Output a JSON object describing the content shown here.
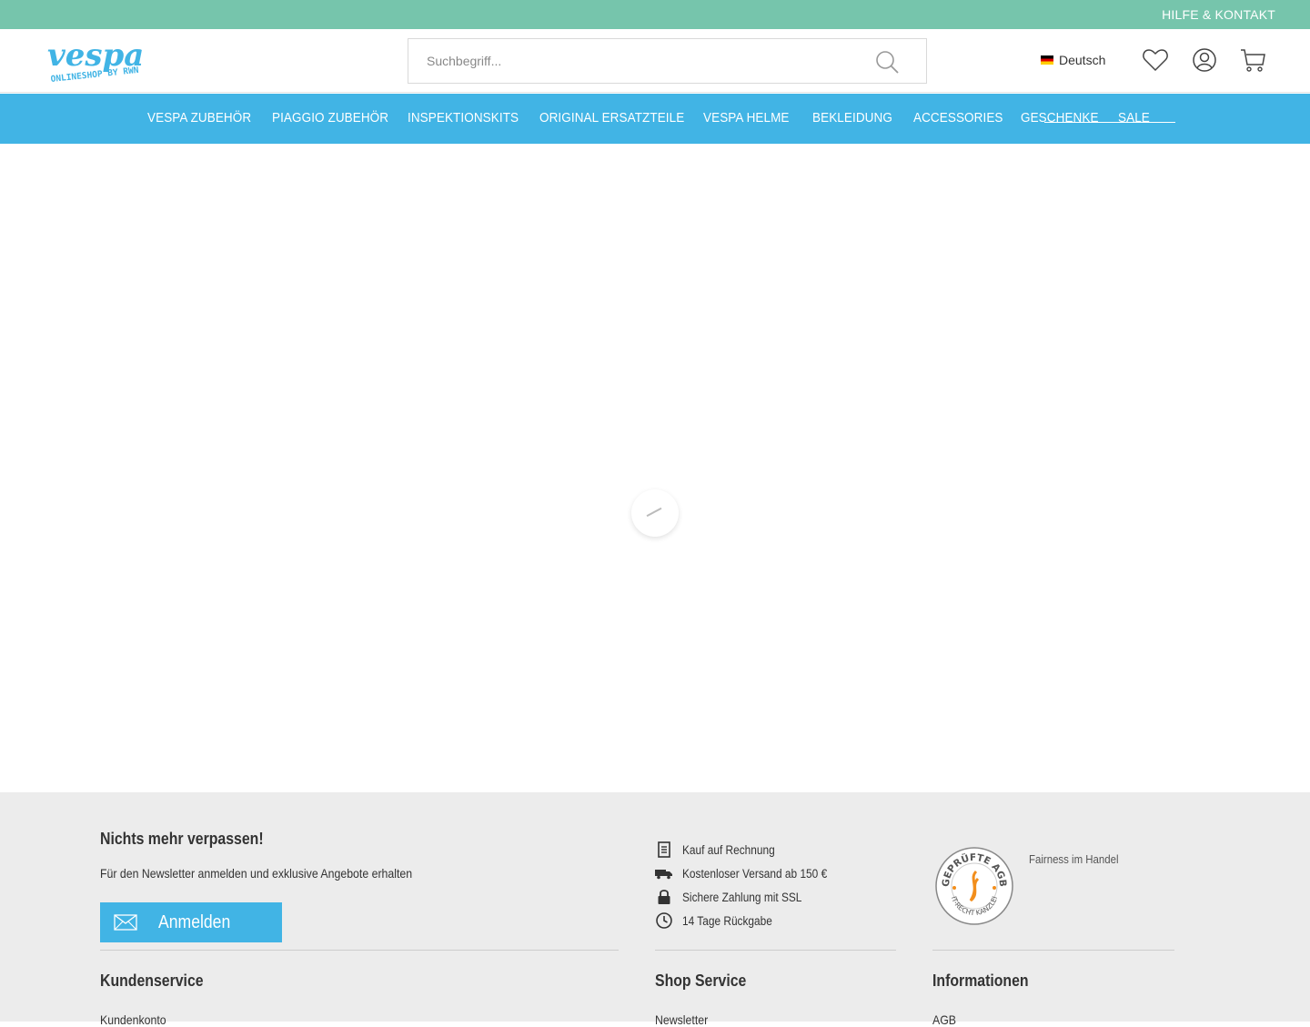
{
  "topbar": {
    "help_link": "HILFE & KONTAKT"
  },
  "header": {
    "logo_text": "vespa",
    "logo_sub": "ONLINESHOP BY RWN",
    "search_placeholder": "Suchbegriff...",
    "language": "Deutsch"
  },
  "nav": {
    "items": [
      "VESPA ZUBEHÖR",
      "PIAGGIO ZUBEHÖR",
      "INSPEKTIONSKITS",
      "ORIGINAL ERSATZTEILE",
      "VESPA HELME",
      "BEKLEIDUNG",
      "ACCESSORIES",
      "GESCHENKE",
      "SALE"
    ]
  },
  "footer": {
    "newsletter": {
      "title": "Nichts mehr verpassen!",
      "text": "Für den Newsletter anmelden und exklusive Angebote erhalten",
      "button": "Anmelden"
    },
    "services": [
      {
        "icon": "invoice-icon",
        "label": "Kauf auf Rechnung"
      },
      {
        "icon": "truck-icon",
        "label": "Kostenloser Versand ab 150 €"
      },
      {
        "icon": "lock-icon",
        "label": "Sichere Zahlung mit SSL"
      },
      {
        "icon": "clock-icon",
        "label": "14 Tage Rückgabe"
      }
    ],
    "badge": {
      "top_text": "GEPRÜFTE AGB",
      "bottom_text": "IT-RECHT KANZLEI"
    },
    "fairness_alt": "Fairness im Handel",
    "columns": [
      {
        "title": "Kundenservice",
        "first_link": "Kundenkonto"
      },
      {
        "title": "Shop Service",
        "first_link": "Newsletter"
      },
      {
        "title": "Informationen",
        "first_link": "AGB"
      }
    ]
  },
  "colors": {
    "topbar": "#76c5ac",
    "nav": "#41b4e5",
    "accent": "#41b4e5",
    "footer_bg": "#ececec"
  }
}
